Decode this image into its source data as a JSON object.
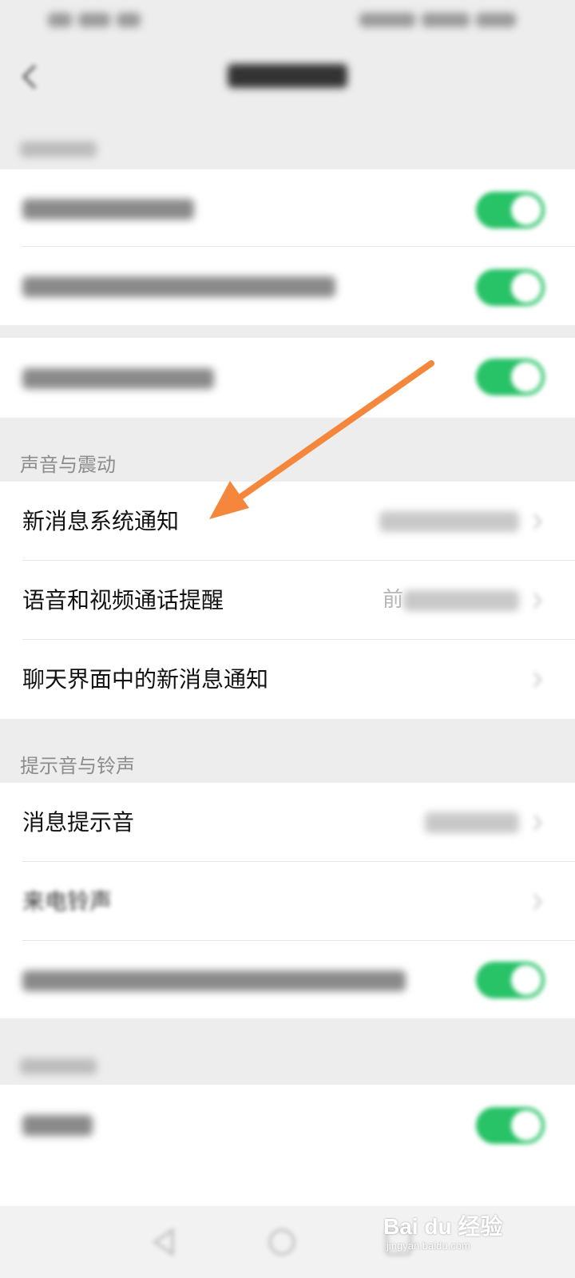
{
  "sections": {
    "sound_vibration_label": "声音与震动",
    "ringtone_label": "提示音与铃声"
  },
  "sound_vibration": [
    {
      "label": "新消息系统通知"
    },
    {
      "label": "语音和视频通话提醒",
      "value": "前"
    },
    {
      "label": "聊天界面中的新消息通知"
    }
  ],
  "ringtones": [
    {
      "label": "消息提示音"
    },
    {
      "label": "来电铃声"
    }
  ],
  "colors": {
    "toggle_on": "#28c267",
    "arrow": "#f5873d"
  },
  "watermark": {
    "brand": "Bai du 经验",
    "domain": "jingyan.baidu.com"
  }
}
